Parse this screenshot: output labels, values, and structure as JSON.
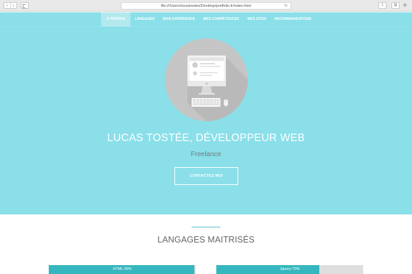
{
  "browser": {
    "url": "file:///Users/lucastostee/Desktop/portfolio.fr/index.html",
    "back_icon": "chevron-left-icon",
    "forward_icon": "chevron-right-icon",
    "reload_icon": "reload-icon"
  },
  "nav": {
    "items": [
      {
        "label": "À PROPOS",
        "active": true
      },
      {
        "label": "LANGAGES",
        "active": false
      },
      {
        "label": "MON EXPÉRIENCE",
        "active": false
      },
      {
        "label": "MES COMPÉTENCES",
        "active": false
      },
      {
        "label": "MES SITES",
        "active": false
      },
      {
        "label": "RECOMMANDATIONS",
        "active": false
      }
    ],
    "color": "#8adfe9"
  },
  "hero": {
    "title": "LUCAS TOSTÉE, DÉVELOPPEUR WEB",
    "subtitle": "Freelance",
    "cta": "CONTACTEZ-MOI",
    "illustration_icon": "computer-illustration-icon"
  },
  "languages": {
    "heading": "LANGAGES MAITRISÉS",
    "skills": [
      {
        "label": "HTML 99%",
        "percent": 99
      },
      {
        "label": "Jquery 70%",
        "percent": 70
      }
    ],
    "accent": "#36b7bf"
  }
}
